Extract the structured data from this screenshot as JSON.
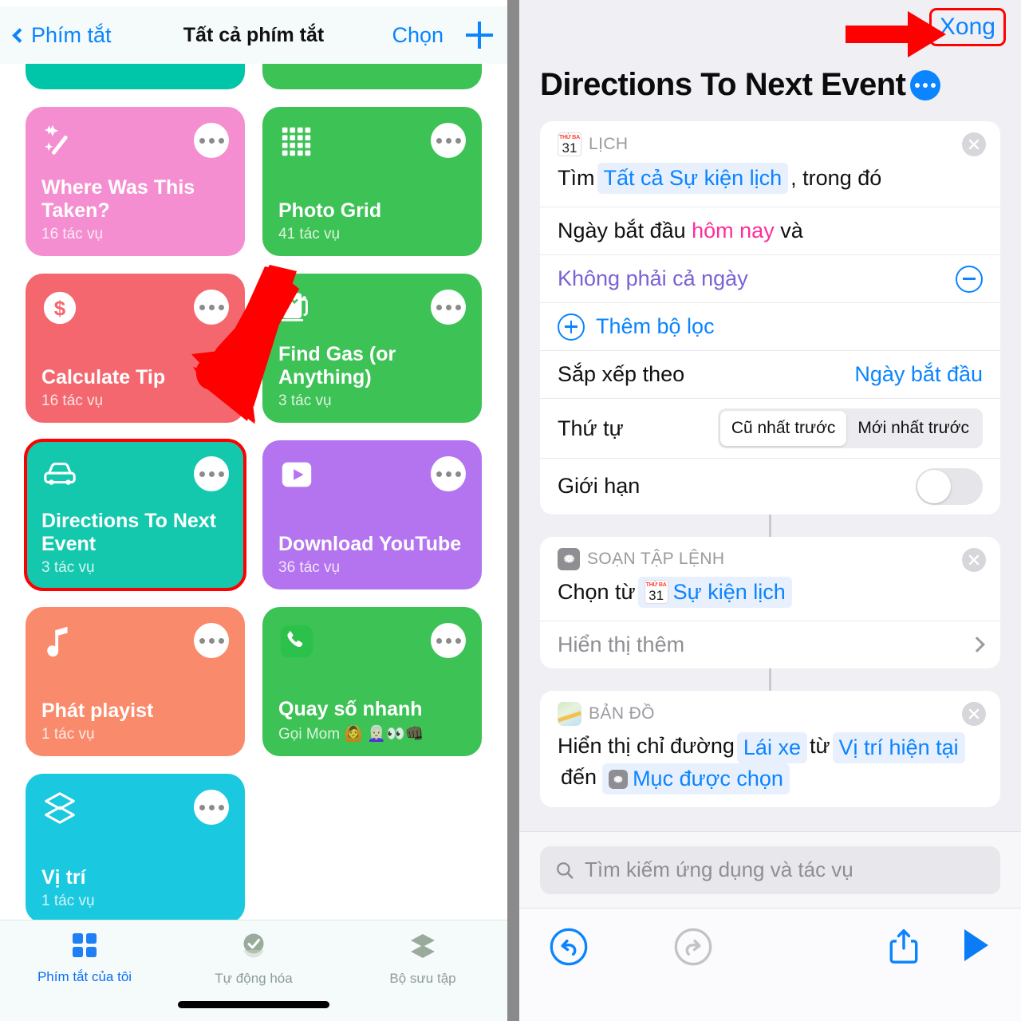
{
  "left": {
    "navbar": {
      "back_label": "Phím tắt",
      "title": "Tất cả phím tắt",
      "choose_label": "Chọn",
      "add_label": "+"
    },
    "cards": [
      {
        "name": "",
        "subtitle": "",
        "color": "#00c6a9",
        "icon": "",
        "stub": true,
        "selected": false
      },
      {
        "name": "",
        "subtitle": "",
        "color": "#3dc255",
        "icon": "",
        "stub": true,
        "selected": false
      },
      {
        "name": "Where Was This Taken?",
        "subtitle": "16 tác vụ",
        "color": "#f48ed0",
        "icon": "magic-wand-icon",
        "stub": false,
        "selected": false
      },
      {
        "name": "Photo Grid",
        "subtitle": "41 tác vụ",
        "color": "#3dc255",
        "icon": "grid-dots-icon",
        "stub": false,
        "selected": false
      },
      {
        "name": "Calculate Tip",
        "subtitle": "16 tác vụ",
        "color": "#f4676f",
        "icon": "dollar-icon",
        "stub": false,
        "selected": false
      },
      {
        "name": "Find Gas (or Anything)",
        "subtitle": "3 tác vụ",
        "color": "#3dc255",
        "icon": "gas-pump-icon",
        "stub": false,
        "selected": false
      },
      {
        "name": "Directions To Next Event",
        "subtitle": "3 tác vụ",
        "color": "#14c8ae",
        "icon": "car-icon",
        "stub": false,
        "selected": true
      },
      {
        "name": "Download YouTube",
        "subtitle": "36 tác vụ",
        "color": "#b474ef",
        "icon": "play-rect-icon",
        "stub": false,
        "selected": false
      },
      {
        "name": "Phát playist",
        "subtitle": "1 tác vụ",
        "color": "#fa8a6c",
        "icon": "music-note-icon",
        "stub": false,
        "selected": false
      },
      {
        "name": "Quay số nhanh",
        "subtitle": "Gọi Mom 🙆 👩🏻‍🦳👀👊🏿",
        "color": "#3dc255",
        "icon": "phone-icon",
        "stub": false,
        "selected": false
      },
      {
        "name": "Vị trí",
        "subtitle": "1 tác vụ",
        "color": "#1ac8e0",
        "icon": "layers-icon",
        "stub": false,
        "selected": false
      }
    ],
    "tabs": [
      {
        "label": "Phím tắt của tôi",
        "icon": "grid-squares-icon",
        "active": true
      },
      {
        "label": "Tự động hóa",
        "icon": "clock-check-icon",
        "active": false
      },
      {
        "label": "Bộ sưu tập",
        "icon": "layers-icon",
        "active": false
      }
    ]
  },
  "right": {
    "done_label": "Xong",
    "title": "Directions To Next Event",
    "cards": [
      {
        "app_label": "LỊCH",
        "app_icon": "calendar-badge-icon",
        "rows": {
          "find_prefix": "Tìm",
          "find_token": "Tất cả Sự kiện lịch",
          "find_suffix": ", trong đó",
          "date_prefix": "Ngày bắt đầu",
          "date_value": "hôm nay",
          "date_suffix": "và",
          "allday_label": "Không phải cả ngày",
          "add_filter_label": "Thêm bộ lọc",
          "sort_label": "Sắp xếp theo",
          "sort_value": "Ngày bắt đầu",
          "order_label": "Thứ tự",
          "order_opt1": "Cũ nhất trước",
          "order_opt2": "Mới nhất trước",
          "limit_label": "Giới hạn"
        }
      },
      {
        "app_label": "SOẠN TẬP LỆNH",
        "app_icon": "gear-badge-icon",
        "rows": {
          "choose_prefix": "Chọn từ",
          "choose_token": "Sự kiện lịch",
          "show_more_label": "Hiển thị thêm"
        }
      },
      {
        "app_label": "BẢN ĐỒ",
        "app_icon": "maps-badge-icon",
        "rows": {
          "dir_prefix": "Hiển thị chỉ đường",
          "dir_mode": "Lái xe",
          "dir_from_word": "từ",
          "dir_from": "Vị trí hiện tại",
          "dir_to_word": "đến",
          "dir_to": "Mục được chọn"
        }
      }
    ],
    "search_placeholder": "Tìm kiếm ứng dụng và tác vụ",
    "toolbar": [
      {
        "icon": "undo-icon",
        "enabled": true
      },
      {
        "icon": "redo-icon",
        "enabled": false
      },
      {
        "icon": "share-icon",
        "enabled": true
      },
      {
        "icon": "play-icon",
        "enabled": true
      }
    ]
  },
  "annotations": {
    "arrow_color": "#ff0000",
    "highlight_color": "#ff0000"
  }
}
